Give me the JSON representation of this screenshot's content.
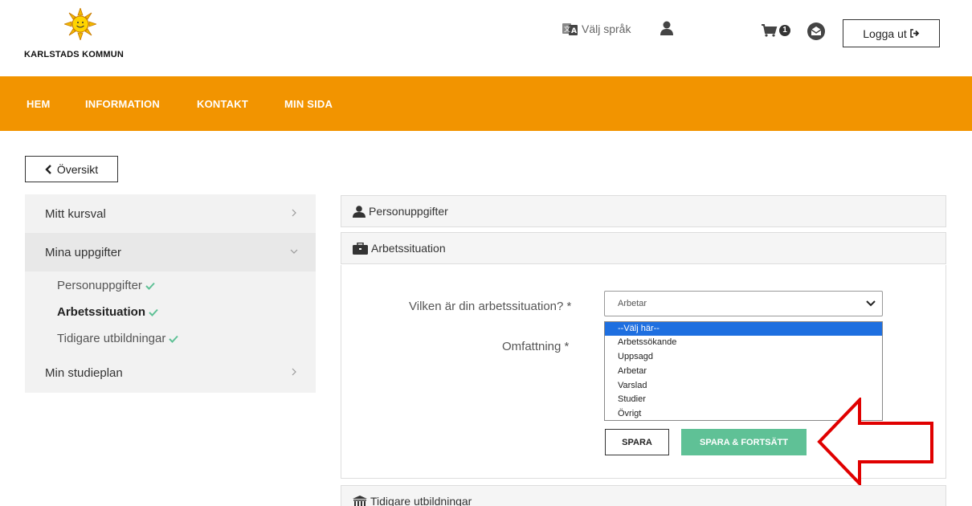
{
  "header": {
    "logo_text": "KARLSTADS KOMMUN",
    "language_label": "Välj språk",
    "cart_count": "1",
    "logout_label": "Logga ut"
  },
  "nav": {
    "items": [
      "HEM",
      "INFORMATION",
      "KONTAKT",
      "MIN SIDA"
    ]
  },
  "back_button": {
    "label": "Översikt"
  },
  "sidebar": {
    "items": [
      {
        "label": "Mitt kursval"
      },
      {
        "label": "Mina uppgifter"
      },
      {
        "label": "Min studieplan"
      }
    ],
    "subitems": [
      {
        "label": "Personuppgifter"
      },
      {
        "label": "Arbetssituation"
      },
      {
        "label": "Tidigare utbildningar"
      }
    ]
  },
  "panels": {
    "personal": "Personuppgifter",
    "work": "Arbetssituation",
    "education": "Tidigare utbildningar"
  },
  "form": {
    "work_question": "Vilken är din arbetssituation? *",
    "scope_label": "Omfattning *",
    "selected_value": "Arbetar",
    "options": [
      "--Välj här--",
      "Arbetssökande",
      "Uppsagd",
      "Arbetar",
      "Varslad",
      "Studier",
      "Övrigt"
    ],
    "highlighted_option": "--Välj här--",
    "save_label": "SPARA",
    "save_continue_label": "SPARA & FORTSÄTT"
  },
  "colors": {
    "nav_bg": "#f29400",
    "save_continue_bg": "#5fc196",
    "arrow": "#e00000",
    "check": "#5fc196"
  }
}
